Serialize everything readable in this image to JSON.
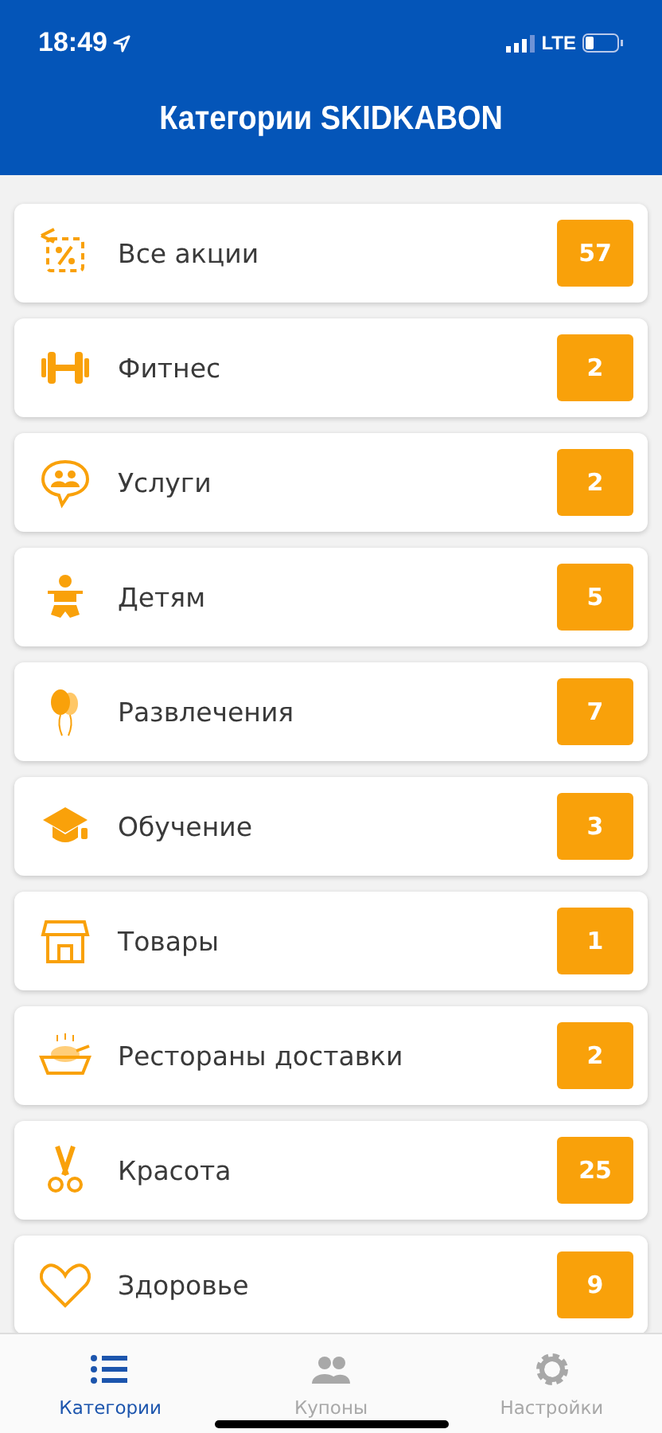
{
  "status_bar": {
    "time": "18:49",
    "network": "LTE"
  },
  "header": {
    "title": "Категории SKIDKABON"
  },
  "categories": [
    {
      "label": "Все акции",
      "count": "57"
    },
    {
      "label": "Фитнес",
      "count": "2"
    },
    {
      "label": "Услуги",
      "count": "2"
    },
    {
      "label": "Детям",
      "count": "5"
    },
    {
      "label": "Развлечения",
      "count": "7"
    },
    {
      "label": "Обучение",
      "count": "3"
    },
    {
      "label": "Товары",
      "count": "1"
    },
    {
      "label": "Рестораны доставки",
      "count": "2"
    },
    {
      "label": "Красота",
      "count": "25"
    },
    {
      "label": "Здоровье",
      "count": "9"
    }
  ],
  "tab_bar": [
    {
      "label": "Категории",
      "selected": true
    },
    {
      "label": "Купоны",
      "selected": false
    },
    {
      "label": "Настройки",
      "selected": false
    }
  ]
}
